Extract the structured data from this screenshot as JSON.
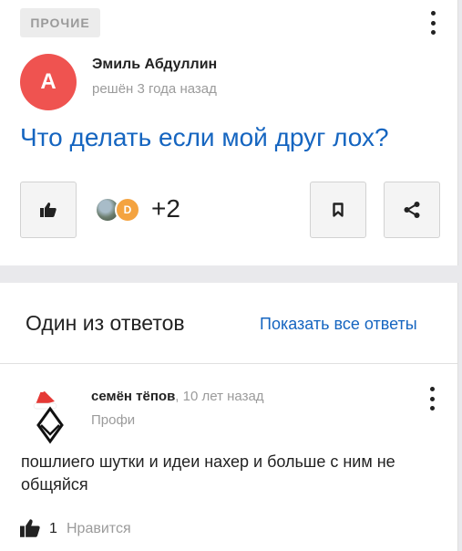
{
  "question": {
    "category": "ПРОЧИЕ",
    "author_initial": "А",
    "author_name": "Эмиль Абдуллин",
    "author_meta": "решён 3 года назад",
    "title": "Что делать если мой друг лох?",
    "participant_initial": "D",
    "participants_more": "+2",
    "colors": {
      "avatar": "#ef5350",
      "link": "#1565c0",
      "participant": "#f4a340"
    },
    "icons": [
      "thumbs-up-icon",
      "bookmark-icon",
      "share-icon",
      "more-vertical-icon"
    ]
  },
  "answers_section": {
    "heading": "Один из ответов",
    "show_all": "Показать все ответы"
  },
  "answer": {
    "author": "семён тёпов",
    "time": ", 10 лет назад",
    "rank": "Профи",
    "text": "пошлиего шутки и идеи нахер и больше с ним не общяйся",
    "likes": "1",
    "likes_label": "Нравится"
  }
}
